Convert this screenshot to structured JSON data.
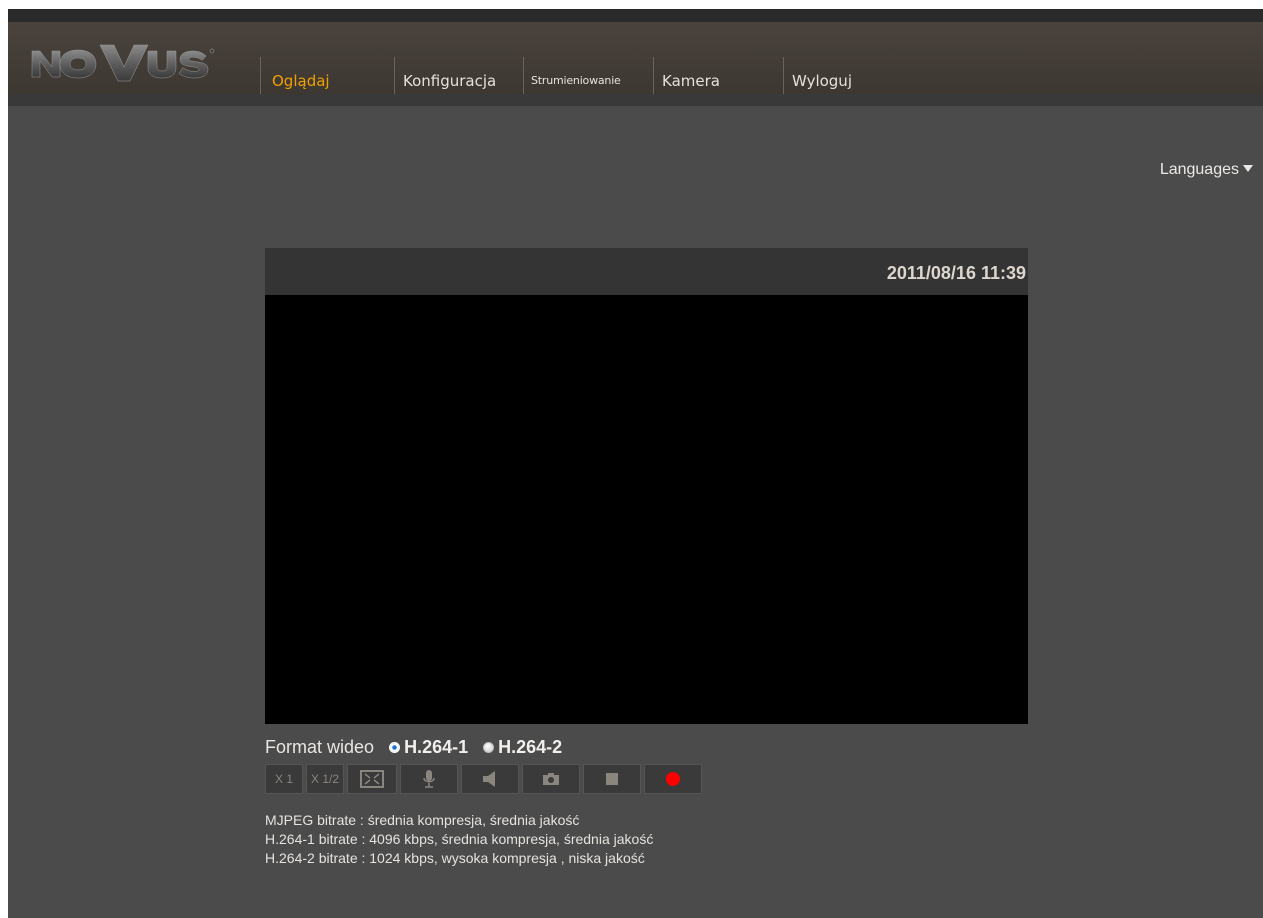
{
  "brand": {
    "logo_text": "NOVUS"
  },
  "nav": {
    "items": [
      {
        "label": "Oglądaj",
        "active": true
      },
      {
        "label": "Konfiguracja",
        "active": false
      },
      {
        "label": "Strumieniowanie",
        "active": false
      },
      {
        "label": "Kamera",
        "active": false
      },
      {
        "label": "Wyloguj",
        "active": false
      }
    ],
    "active_color": "#f0a000"
  },
  "languages": {
    "label": "Languages"
  },
  "video": {
    "timestamp": "2011/08/16 11:39"
  },
  "format": {
    "label": "Format wideo",
    "options": [
      {
        "label": "H.264-1",
        "selected": true
      },
      {
        "label": "H.264-2",
        "selected": false
      }
    ]
  },
  "controls": {
    "zoom_x1": "X 1",
    "zoom_x1_2": "X 1/2",
    "icons": [
      "fit-screen-icon",
      "microphone-icon",
      "speaker-icon",
      "camera-icon",
      "stop-icon",
      "record-icon"
    ]
  },
  "info": {
    "line1": "MJPEG bitrate : średnia kompresja, średnia jakość",
    "line2": "H.264-1 bitrate : 4096 kbps, średnia kompresja, średnia jakość",
    "line3": "H.264-2 bitrate : 1024 kbps, wysoka kompresja , niska jakość"
  },
  "colors": {
    "background": "#4b4b4b",
    "record": "#ff0000"
  }
}
